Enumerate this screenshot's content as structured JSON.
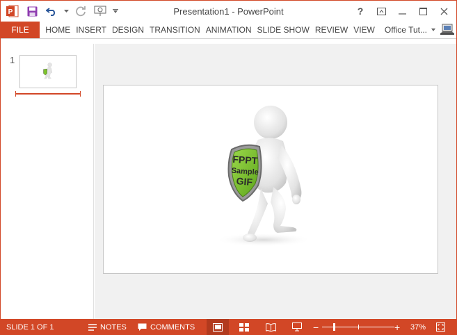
{
  "window": {
    "title": "Presentation1 - PowerPoint"
  },
  "qat": {
    "icons": [
      "powerpoint-logo-icon",
      "save-icon",
      "undo-icon",
      "undo-dropdown-icon",
      "redo-icon",
      "start-from-beginning-icon",
      "customize-qat-icon"
    ]
  },
  "window_controls": {
    "help": "?",
    "icons": [
      "help-icon",
      "ribbon-display-options-icon",
      "minimize-icon",
      "restore-icon",
      "close-icon"
    ]
  },
  "ribbon": {
    "file_label": "FILE",
    "tabs": [
      "HOME",
      "INSERT",
      "DESIGN",
      "TRANSITION",
      "ANIMATION",
      "SLIDE SHOW",
      "REVIEW",
      "VIEW"
    ],
    "account": "Office Tut...",
    "accent_color": "#d24726"
  },
  "thumbnails": {
    "slide_number": "1"
  },
  "slide": {
    "shield_text": [
      "FPPT",
      "Sample",
      "GIF"
    ],
    "shield_color": "#7dc42b"
  },
  "statusbar": {
    "slide_info": "SLIDE 1 OF 1",
    "notes_label": "NOTES",
    "comments_label": "COMMENTS",
    "zoom_percent": "37%",
    "zoom_level": 0.37,
    "active_view": "normal"
  }
}
